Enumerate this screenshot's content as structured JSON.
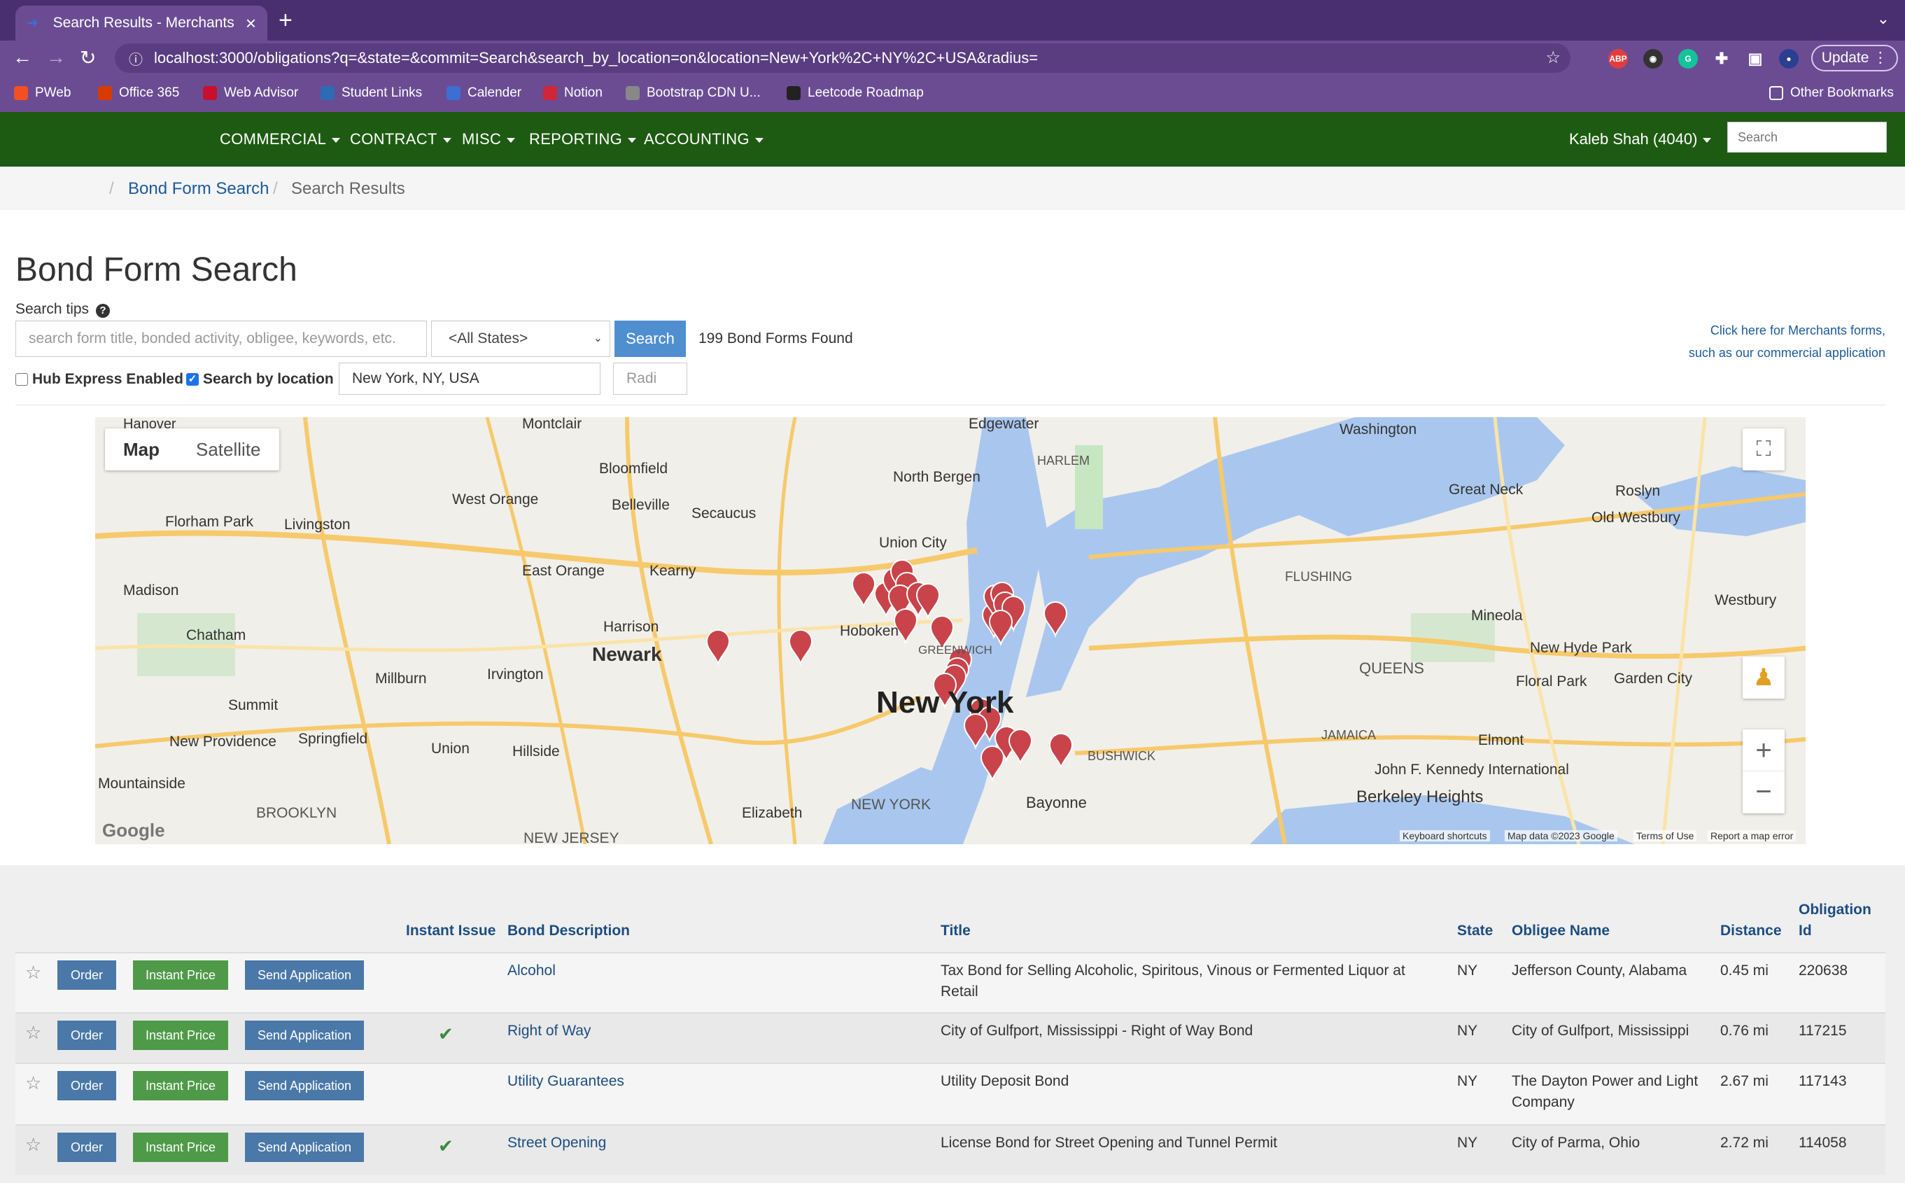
{
  "browser": {
    "tab_title": "Search Results - Merchants Bo",
    "url": "localhost:3000/obligations?q=&state=&commit=Search&search_by_location=on&location=New+York%2C+NY%2C+USA&radius=",
    "update_label": "Update",
    "bookmarks": [
      "PWeb",
      "Office 365",
      "Web Advisor",
      "Student Links",
      "Calender",
      "Notion",
      "Bootstrap CDN U...",
      "Leetcode Roadmap",
      "Other Bookmarks"
    ]
  },
  "appnav": {
    "menus": [
      "COMMERCIAL",
      "CONTRACT",
      "MISC",
      "REPORTING",
      "ACCOUNTING"
    ],
    "user": "Kaleb Shah (4040)",
    "search_placeholder": "Search"
  },
  "breadcrumb": {
    "sep": "/",
    "parent": "Bond Form Search",
    "current": "Search Results"
  },
  "search": {
    "heading": "Bond Form Search",
    "tips_label": "Search tips",
    "query_placeholder": "search form title, bonded activity, obligee, keywords, etc.",
    "state_selected": "<All States>",
    "search_button": "Search",
    "results_count": "199 Bond Forms Found",
    "merchants_link_1": "Click here for Merchants forms,",
    "merchants_link_2": "such as our commercial application",
    "hub_express_label": "Hub Express Enabled",
    "hub_express_checked": false,
    "search_by_location_label": "Search by location",
    "search_by_location_checked": true,
    "location_value": "New York, NY, USA",
    "radius_placeholder": "Radi"
  },
  "map": {
    "tab_map": "Map",
    "tab_satellite": "Satellite",
    "city_label": "New York",
    "zoom_in": "+",
    "zoom_out": "−",
    "labels": [
      "Hanover",
      "Montclair",
      "Edgewater",
      "HARLEM",
      "Washington",
      "Bloomfield",
      "North Bergen",
      "West Orange",
      "Belleville",
      "Great Neck",
      "Roslyn",
      "Florham Park",
      "Livingston",
      "Secaucus",
      "Union City",
      "Old Westbury",
      "East Orange",
      "Kearny",
      "FLUSHING",
      "Madison",
      "Harrison",
      "Westbury",
      "Chatham",
      "Newark",
      "Hoboken",
      "GREENWICH",
      "Mineola",
      "New Hyde Park",
      "QUEENS",
      "Millburn",
      "Irvington",
      "Floral Park",
      "Garden City",
      "Summit",
      "Springfield",
      "Union",
      "Hillside",
      "JAMAICA",
      "Elmont",
      "New Providence",
      "BUSHWICK",
      "John F. Kennedy International",
      "Berkeley Heights",
      "Mountainside",
      "BROOKLYN",
      "Bayonne",
      "Elizabeth",
      "NEW JERSEY",
      "NEW YORK"
    ],
    "footer": [
      "Keyboard shortcuts",
      "Map data ©2023 Google",
      "Terms of Use",
      "Report a map error"
    ],
    "google_logo": "Google"
  },
  "table": {
    "headers": {
      "instant_issue": "Instant Issue",
      "bond_description": "Bond Description",
      "title": "Title",
      "state": "State",
      "obligee": "Obligee Name",
      "distance": "Distance",
      "obligation_id_1": "Obligation",
      "obligation_id_2": "Id"
    },
    "buttons": {
      "order": "Order",
      "instant": "Instant Price",
      "send": "Send Application"
    },
    "rows": [
      {
        "desc": "Alcohol",
        "instant": false,
        "title_1": "Tax Bond for Selling Alcoholic, Spiritous, Vinous or Fermented Liquor at",
        "title_2": "Retail",
        "state": "NY",
        "obligee_1": "Jefferson County, Alabama",
        "obligee_2": "",
        "distance": "0.45 mi",
        "id": "220638"
      },
      {
        "desc": "Right of Way",
        "instant": true,
        "title_1": "City of Gulfport, Mississippi - Right of Way Bond",
        "title_2": "",
        "state": "NY",
        "obligee_1": "City of Gulfport, Mississippi",
        "obligee_2": "",
        "distance": "0.76 mi",
        "id": "117215"
      },
      {
        "desc": "Utility Guarantees",
        "instant": false,
        "title_1": "Utility Deposit Bond",
        "title_2": "",
        "state": "NY",
        "obligee_1": "The Dayton Power and Light",
        "obligee_2": "Company",
        "distance": "2.67 mi",
        "id": "117143"
      },
      {
        "desc": "Street Opening",
        "instant": true,
        "title_1": "License Bond for Street Opening and Tunnel Permit",
        "title_2": "",
        "state": "NY",
        "obligee_1": "City of Parma, Ohio",
        "obligee_2": "",
        "distance": "2.72 mi",
        "id": "114058"
      }
    ]
  },
  "colors": {
    "browser": "#6b4c93",
    "appnav": "#1e5b12",
    "search_button": "#4f8fd0",
    "order_button": "#4a78a8",
    "instant_button": "#4f9a48",
    "pin": "#c8444a"
  }
}
